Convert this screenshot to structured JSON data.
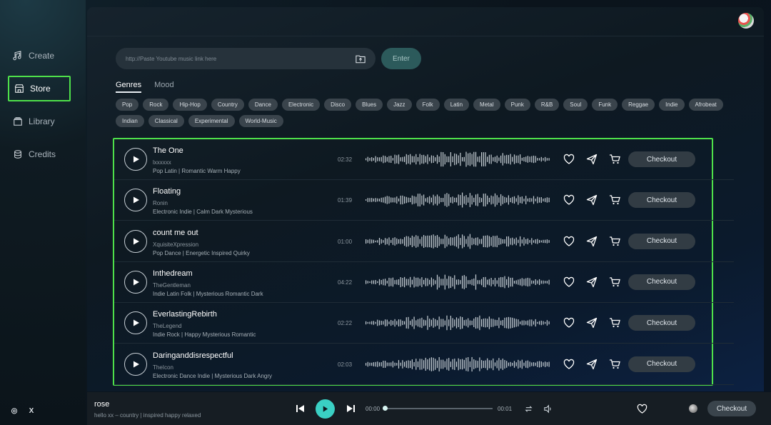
{
  "nav": {
    "create": "Create",
    "store": "Store",
    "library": "Library",
    "credits": "Credits"
  },
  "social": {
    "instagram": "◎",
    "x": "X"
  },
  "search": {
    "placeholder": "http://Paste Youtube music link here",
    "enter_label": "Enter"
  },
  "tabs": [
    "Genres",
    "Mood"
  ],
  "genres": [
    "Pop",
    "Rock",
    "Hip-Hop",
    "Country",
    "Dance",
    "Electronic",
    "Disco",
    "Blues",
    "Jazz",
    "Folk",
    "Latin",
    "Metal",
    "Punk",
    "R&B",
    "Soul",
    "Funk",
    "Reggae",
    "Indie",
    "Afrobeat",
    "Indian",
    "Classical",
    "Experimental",
    "World-Music"
  ],
  "tracks": [
    {
      "title": "The One",
      "artist": "lxxxxxx",
      "tags": "Pop Latin | Romantic Warm Happy",
      "duration": "02:32",
      "checkout": "Checkout"
    },
    {
      "title": "Floating",
      "artist": "Ronin",
      "tags": "Electronic Indie | Calm Dark Mysterious",
      "duration": "01:39",
      "checkout": "Checkout"
    },
    {
      "title": "count me out",
      "artist": "XquisiteXpression",
      "tags": "Pop Dance | Energetic Inspired Quirky",
      "duration": "01:00",
      "checkout": "Checkout"
    },
    {
      "title": "Inthedream",
      "artist": "TheGentleman",
      "tags": "Indie Latin Folk | Mysterious Romantic Dark",
      "duration": "04:22",
      "checkout": "Checkout"
    },
    {
      "title": "EverlastingRebirth",
      "artist": "TheLegend",
      "tags": "Indie Rock | Happy Mysterious Romantic",
      "duration": "02:22",
      "checkout": "Checkout"
    },
    {
      "title": "Daringanddisrespectful",
      "artist": "TheIcon",
      "tags": "Electronic Dance Indie | Mysterious Dark Angry",
      "duration": "02:03",
      "checkout": "Checkout"
    }
  ],
  "player": {
    "title": "rose",
    "subtitle": "hello xx – country | inspired happy relaxed",
    "current_time": "00:00",
    "total_time": "00:01",
    "progress": 0,
    "checkout": "Checkout"
  },
  "colors": {
    "accent": "#3ad0c4",
    "highlight": "#4ee04a"
  }
}
